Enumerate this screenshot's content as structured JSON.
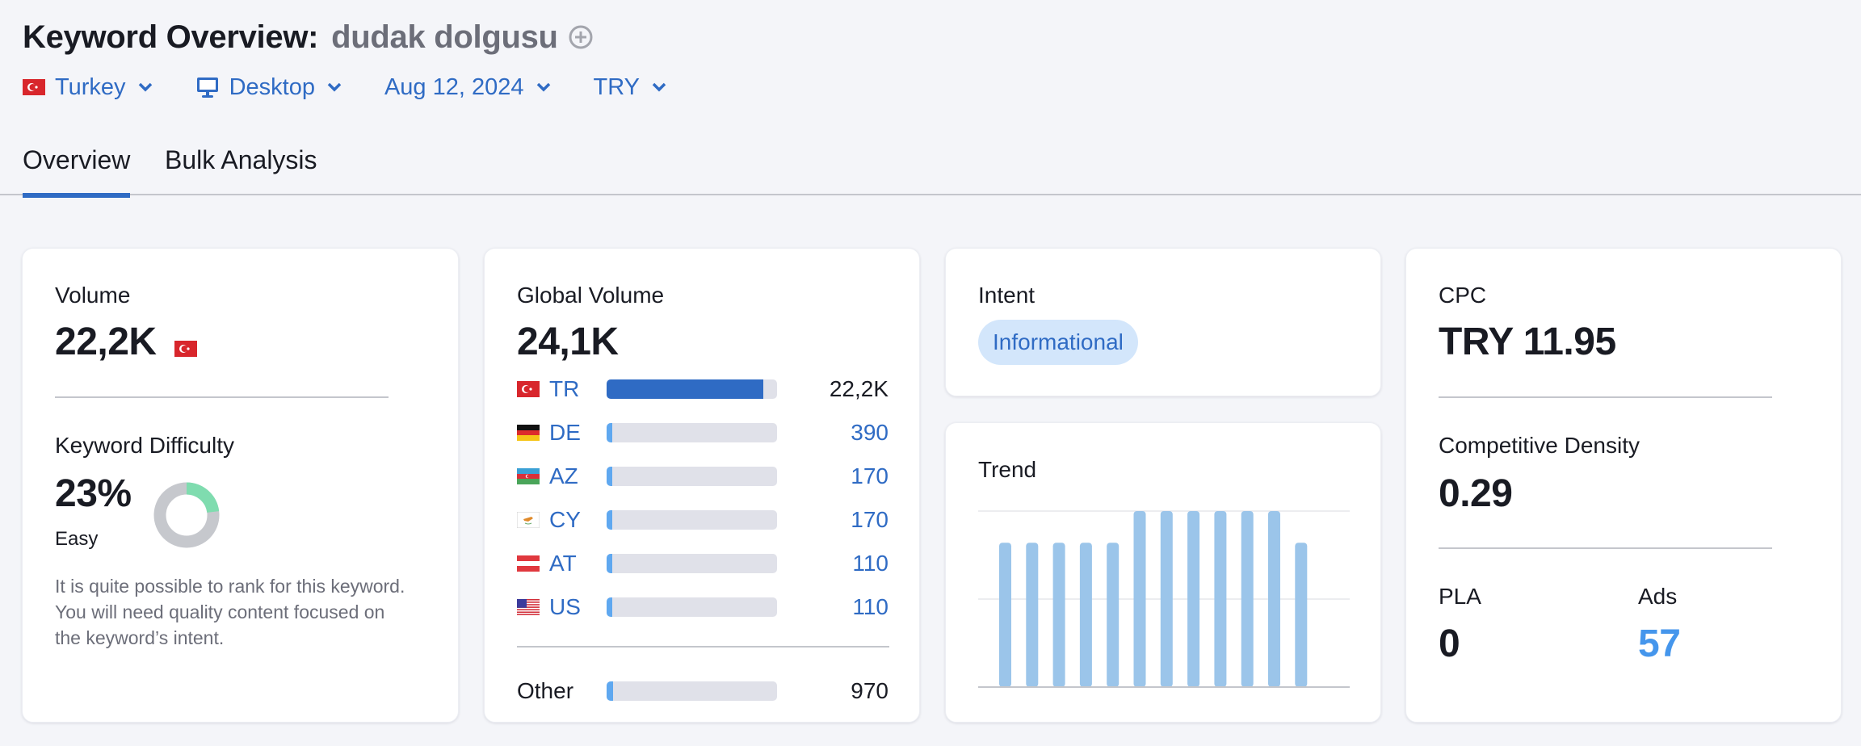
{
  "header": {
    "title": "Keyword Overview:",
    "keyword": "dudak dolgusu",
    "add_icon": "plus-circle-icon"
  },
  "filters": [
    {
      "label": "Turkey",
      "icon": "flag-tr"
    },
    {
      "label": "Desktop",
      "icon": "monitor-icon"
    },
    {
      "label": "Aug 12, 2024",
      "icon": null
    },
    {
      "label": "TRY",
      "icon": null
    }
  ],
  "tabs": [
    {
      "label": "Overview",
      "active": true
    },
    {
      "label": "Bulk Analysis",
      "active": false
    }
  ],
  "volume": {
    "label": "Volume",
    "value": "22,2K",
    "flag": "flag-tr"
  },
  "keyword_difficulty": {
    "label": "Keyword Difficulty",
    "value": "23%",
    "percent": 23,
    "level": "Easy",
    "description": "It is quite possible to rank for this keyword. You will need quality content focused on the keyword’s intent.",
    "color": "#7fdcaf"
  },
  "global_volume": {
    "label": "Global Volume",
    "value": "24,1K",
    "countries": [
      {
        "code": "TR",
        "flag": "flag-tr",
        "value": "22,2K",
        "fraction": 0.92,
        "highlight": true
      },
      {
        "code": "DE",
        "flag": "flag-de",
        "value": "390",
        "fraction": 0.02
      },
      {
        "code": "AZ",
        "flag": "flag-az",
        "value": "170",
        "fraction": 0.02
      },
      {
        "code": "CY",
        "flag": "flag-cy",
        "value": "170",
        "fraction": 0.02
      },
      {
        "code": "AT",
        "flag": "flag-at",
        "value": "110",
        "fraction": 0.02
      },
      {
        "code": "US",
        "flag": "flag-us",
        "value": "110",
        "fraction": 0.02
      }
    ],
    "other": {
      "label": "Other",
      "value": "970",
      "fraction": 0.03
    }
  },
  "intent": {
    "label": "Intent",
    "value": "Informational"
  },
  "trend": {
    "label": "Trend"
  },
  "chart_data": {
    "type": "bar",
    "title": "Trend",
    "categories": [
      "1",
      "2",
      "3",
      "4",
      "5",
      "6",
      "7",
      "8",
      "9",
      "10",
      "11",
      "12"
    ],
    "values": [
      0.82,
      0.82,
      0.82,
      0.82,
      0.82,
      1.0,
      1.0,
      1.0,
      1.0,
      1.0,
      1.0,
      0.82
    ],
    "ylim": [
      0,
      1
    ],
    "grid": true,
    "xlabel": "",
    "ylabel": "",
    "color": "#9bc5ea"
  },
  "cpc": {
    "label": "CPC",
    "value": "TRY 11.95"
  },
  "competitive_density": {
    "label": "Competitive Density",
    "value": "0.29"
  },
  "pla": {
    "label": "PLA",
    "value": "0"
  },
  "ads": {
    "label": "Ads",
    "value": "57"
  },
  "colors": {
    "accent": "#2f6bc4",
    "link": "#4596ec",
    "bar_bg": "#e0e1e9",
    "bar_small": "#5fa8f0",
    "difficulty_track": "#c6c8cd"
  }
}
